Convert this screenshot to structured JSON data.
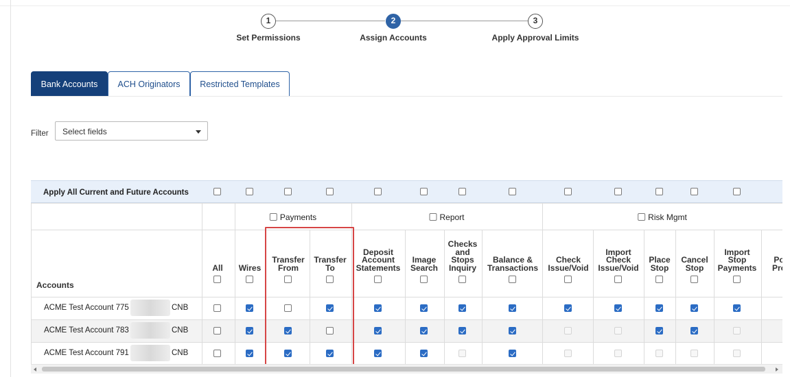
{
  "stepper": {
    "steps": [
      {
        "number": "1",
        "label": "Set Permissions",
        "active": false
      },
      {
        "number": "2",
        "label": "Assign Accounts",
        "active": true
      },
      {
        "number": "3",
        "label": "Apply Approval Limits",
        "active": false
      }
    ]
  },
  "tabs": [
    {
      "label": "Bank Accounts",
      "active": true
    },
    {
      "label": "ACH Originators",
      "active": false
    },
    {
      "label": "Restricted Templates",
      "active": false
    }
  ],
  "filter": {
    "label": "Filter",
    "value": "Select fields"
  },
  "table": {
    "apply_label": "Apply All Current and Future Accounts",
    "accounts_header": "Accounts",
    "groups": [
      {
        "label": "Payments"
      },
      {
        "label": "Report"
      },
      {
        "label": "Risk Mgmt"
      }
    ],
    "columns": [
      {
        "label": "All"
      },
      {
        "label": "Wires"
      },
      {
        "label": "Transfer\nFrom"
      },
      {
        "label": "Transfer\nTo"
      },
      {
        "label": "Deposit\nAccount\nStatements"
      },
      {
        "label": "Image\nSearch"
      },
      {
        "label": "Checks\nand\nStops\nInquiry"
      },
      {
        "label": "Balance &\nTransactions"
      },
      {
        "label": "Check\nIssue/Void"
      },
      {
        "label": "Import\nCheck\nIssue/Void"
      },
      {
        "label": "Place\nStop"
      },
      {
        "label": "Cancel\nStop"
      },
      {
        "label": "Import\nStop\nPayments"
      },
      {
        "label": "Po\nPro"
      }
    ],
    "rows": [
      {
        "name": "ACME Test Account 775 -",
        "suffix": "CNB",
        "cells": [
          "u",
          "c",
          "u",
          "c",
          "c",
          "c",
          "c",
          "c",
          "c",
          "c",
          "c",
          "c",
          "c"
        ]
      },
      {
        "name": "ACME Test Account 783 -",
        "suffix": "CNB",
        "cells": [
          "u",
          "c",
          "c",
          "u",
          "c",
          "c",
          "c",
          "c",
          "d",
          "d",
          "c",
          "c",
          "d"
        ]
      },
      {
        "name": "ACME Test Account 791 -",
        "suffix": "CNB",
        "cells": [
          "u",
          "c",
          "c",
          "c",
          "c",
          "c",
          "d",
          "c",
          "d",
          "d",
          "d",
          "d",
          "d"
        ]
      }
    ]
  },
  "colors": {
    "accent": "#2f63a6",
    "tab_active": "#15407a",
    "checkbox": "#2b6cc4",
    "highlight": "#d64545"
  }
}
